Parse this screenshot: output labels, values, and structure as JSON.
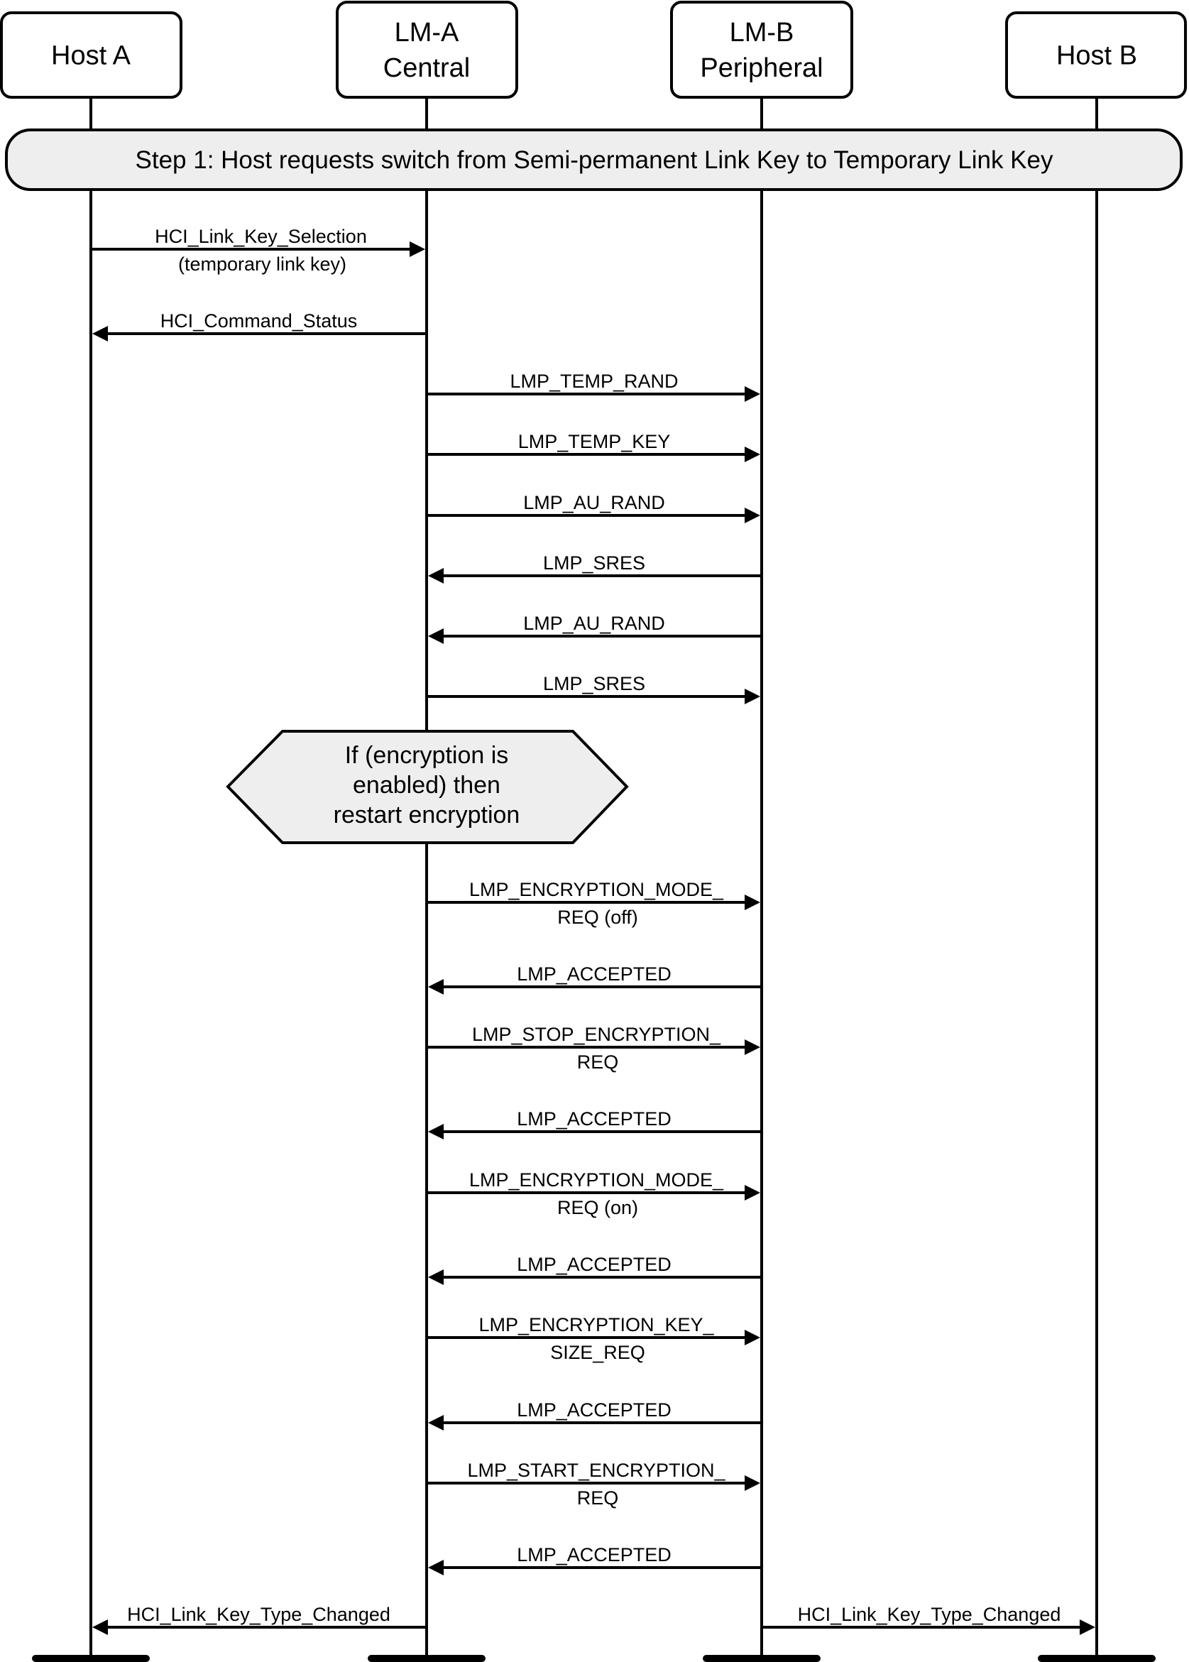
{
  "colors": {
    "line": "#000000",
    "fill_shaded": "#eeeeee",
    "background": "#ffffff"
  },
  "participants": [
    {
      "id": "hostA",
      "lines": [
        "Host A"
      ]
    },
    {
      "id": "lmA",
      "lines": [
        "LM-A",
        "Central"
      ]
    },
    {
      "id": "lmB",
      "lines": [
        "LM-B",
        "Peripheral"
      ]
    },
    {
      "id": "hostB",
      "lines": [
        "Host B"
      ]
    }
  ],
  "step_banner": "Step 1:  Host requests switch from Semi-permanent Link Key to Temporary Link Key",
  "condition_box": [
    "If (encryption is",
    "enabled) then",
    "restart encryption"
  ],
  "messages": [
    {
      "from": "hostA",
      "to": "lmA",
      "above": "HCI_Link_Key_Selection",
      "below": "(temporary link key)"
    },
    {
      "from": "lmA",
      "to": "hostA",
      "above": "HCI_Command_Status",
      "below": ""
    },
    {
      "from": "lmA",
      "to": "lmB",
      "above": "LMP_TEMP_RAND",
      "below": ""
    },
    {
      "from": "lmA",
      "to": "lmB",
      "above": "LMP_TEMP_KEY",
      "below": ""
    },
    {
      "from": "lmA",
      "to": "lmB",
      "above": "LMP_AU_RAND",
      "below": ""
    },
    {
      "from": "lmB",
      "to": "lmA",
      "above": "LMP_SRES",
      "below": ""
    },
    {
      "from": "lmB",
      "to": "lmA",
      "above": "LMP_AU_RAND",
      "below": ""
    },
    {
      "from": "lmA",
      "to": "lmB",
      "above": "LMP_SRES",
      "below": ""
    },
    {
      "from": "lmA",
      "to": "lmB",
      "above": "LMP_ENCRYPTION_MODE_",
      "below": "REQ (off)"
    },
    {
      "from": "lmB",
      "to": "lmA",
      "above": "LMP_ACCEPTED",
      "below": ""
    },
    {
      "from": "lmA",
      "to": "lmB",
      "above": "LMP_STOP_ENCRYPTION_",
      "below": "REQ"
    },
    {
      "from": "lmB",
      "to": "lmA",
      "above": "LMP_ACCEPTED",
      "below": ""
    },
    {
      "from": "lmA",
      "to": "lmB",
      "above": "LMP_ENCRYPTION_MODE_",
      "below": "REQ (on)"
    },
    {
      "from": "lmB",
      "to": "lmA",
      "above": "LMP_ACCEPTED",
      "below": ""
    },
    {
      "from": "lmA",
      "to": "lmB",
      "above": "LMP_ENCRYPTION_KEY_",
      "below": "SIZE_REQ"
    },
    {
      "from": "lmB",
      "to": "lmA",
      "above": "LMP_ACCEPTED",
      "below": ""
    },
    {
      "from": "lmA",
      "to": "lmB",
      "above": "LMP_START_ENCRYPTION_",
      "below": "REQ"
    },
    {
      "from": "lmB",
      "to": "lmA",
      "above": "LMP_ACCEPTED",
      "below": ""
    },
    {
      "from": "lmA",
      "to": "hostA",
      "above": "HCI_Link_Key_Type_Changed",
      "below": ""
    },
    {
      "from": "lmB",
      "to": "hostB",
      "above": "HCI_Link_Key_Type_Changed",
      "below": ""
    }
  ]
}
